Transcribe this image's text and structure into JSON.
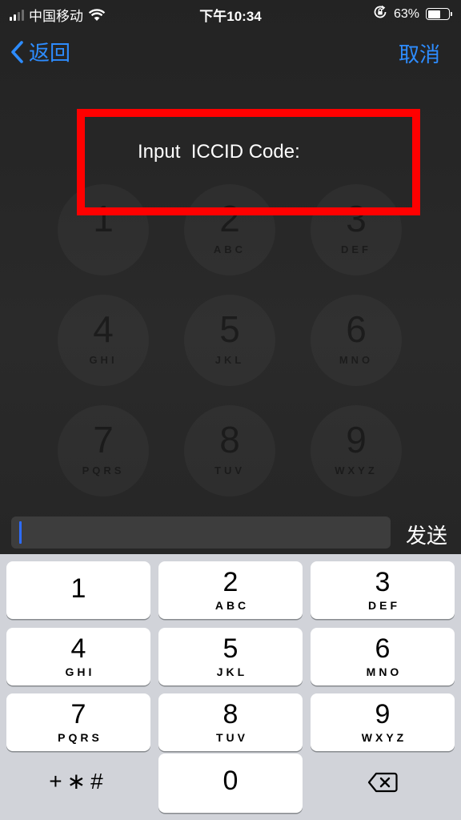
{
  "status_bar": {
    "carrier": "中国移动",
    "time": "下午10:34",
    "battery_percent": "63%",
    "battery_level": 0.63,
    "icons": [
      "signal-icon",
      "wifi-icon",
      "orientation-lock-icon",
      "battery-icon"
    ]
  },
  "nav": {
    "back_label": "返回",
    "cancel_label": "取消",
    "accent_color": "#2d8cff"
  },
  "alert": {
    "message": "Input  ICCID Code:",
    "highlight_color": "#ff0000"
  },
  "background_dialpad": [
    {
      "digit": "1",
      "letters": ""
    },
    {
      "digit": "2",
      "letters": "ABC"
    },
    {
      "digit": "3",
      "letters": "DEF"
    },
    {
      "digit": "4",
      "letters": "GHI"
    },
    {
      "digit": "5",
      "letters": "JKL"
    },
    {
      "digit": "6",
      "letters": "MNO"
    },
    {
      "digit": "7",
      "letters": "PQRS"
    },
    {
      "digit": "8",
      "letters": "TUV"
    },
    {
      "digit": "9",
      "letters": "WXYZ"
    }
  ],
  "input": {
    "value": "",
    "send_label": "发送"
  },
  "keypad": {
    "keys": [
      {
        "digit": "1",
        "letters": ""
      },
      {
        "digit": "2",
        "letters": "ABC"
      },
      {
        "digit": "3",
        "letters": "DEF"
      },
      {
        "digit": "4",
        "letters": "GHI"
      },
      {
        "digit": "5",
        "letters": "JKL"
      },
      {
        "digit": "6",
        "letters": "MNO"
      },
      {
        "digit": "7",
        "letters": "PQRS"
      },
      {
        "digit": "8",
        "letters": "TUV"
      },
      {
        "digit": "9",
        "letters": "WXYZ"
      }
    ],
    "symbols_label": "+∗#",
    "zero": "0",
    "delete_icon": "backspace-icon"
  }
}
